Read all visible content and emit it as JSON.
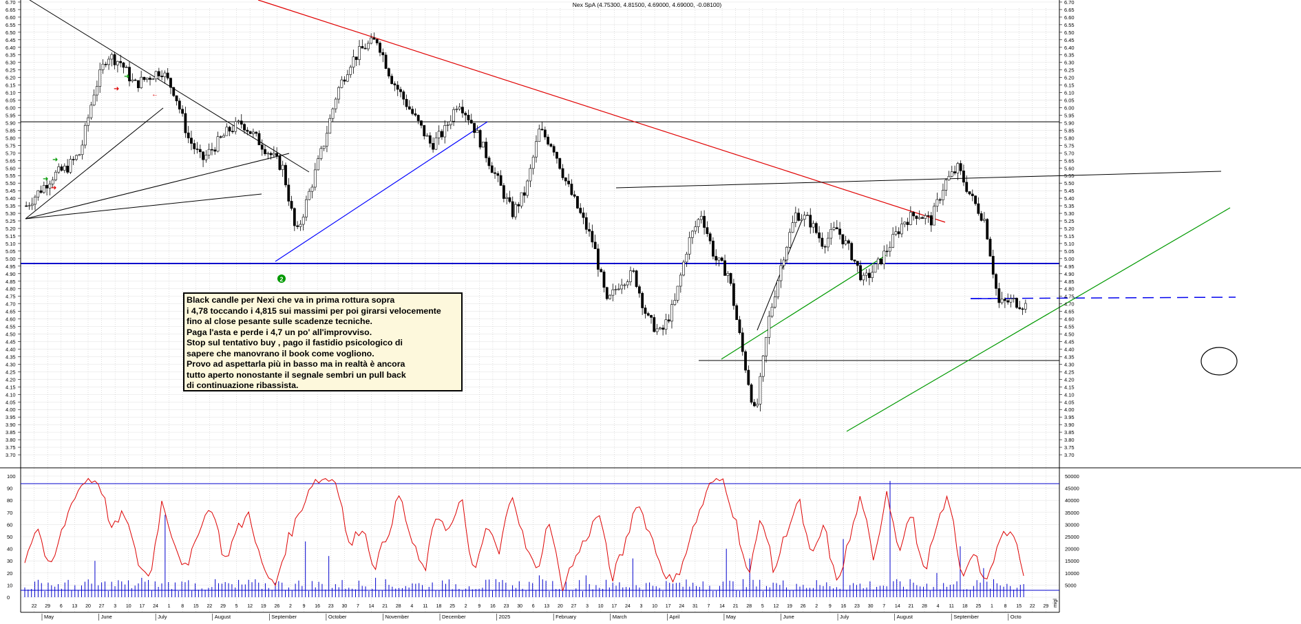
{
  "title": "Nex SpA (4.75300, 4.81500, 4.69000, 4.69000, -0.08100)",
  "colors": {
    "up_candle": "#ffffff",
    "down_candle": "#000000",
    "support_line": "#0000cc",
    "red_trendline": "#e00000",
    "blue_trendline": "#0000ff",
    "green_trendline": "#009900",
    "oscillator": "#dd0000",
    "volume": "#0000cc",
    "annotation_bg": "#fdf8dc"
  },
  "annotation": {
    "lines": [
      "Black candle per Nexi che va in prima rottura sopra",
      "i 4,78 toccando i 4,815 sui massimi per poi girarsi velocemente",
      "fino al close pesante sulle scadenze tecniche.",
      "Paga l'asta e perde i 4,7 un po' all'improvviso.",
      "Stop sul tentativo buy , pago il fastidio psicologico di",
      "sapere che manovrano il book come vogliono.",
      "Provo ad aspettarla più in basso ma in realtà è ancora",
      "tutto aperto nonostante il segnale sembri un pull back",
      "di continuazione ribassista."
    ]
  },
  "marker_label": "2",
  "volume_axis_unit": "migl",
  "chart_data": [
    {
      "type": "candlestick",
      "title": "Nex SpA (4.75300, 4.81500, 4.69000, 4.69000, -0.08100)",
      "ylim": [
        3.65,
        6.75
      ],
      "y_ticks": [
        "6.70",
        "6.65",
        "6.60",
        "6.55",
        "6.50",
        "6.45",
        "6.40",
        "6.35",
        "6.30",
        "6.25",
        "6.20",
        "6.15",
        "6.10",
        "6.05",
        "6.00",
        "5.95",
        "5.90",
        "5.85",
        "5.80",
        "5.75",
        "5.70",
        "5.65",
        "5.60",
        "5.55",
        "5.50",
        "5.45",
        "5.40",
        "5.35",
        "5.30",
        "5.25",
        "5.20",
        "5.15",
        "5.10",
        "5.05",
        "5.00",
        "4.95",
        "4.90",
        "4.85",
        "4.80",
        "4.75",
        "4.70",
        "4.65",
        "4.60",
        "4.55",
        "4.50",
        "4.45",
        "4.40",
        "4.35",
        "4.30",
        "4.25",
        "4.20",
        "4.15",
        "4.10",
        "4.05",
        "4.00",
        "3.95",
        "3.90",
        "3.85",
        "3.80",
        "3.75",
        "3.70"
      ],
      "last_candle": {
        "open": 4.753,
        "high": 4.815,
        "low": 4.69,
        "close": 4.69,
        "change": -0.081
      },
      "price_path": [
        5.35,
        5.45,
        5.55,
        5.6,
        5.7,
        6.1,
        6.35,
        6.3,
        6.15,
        6.2,
        6.25,
        6.1,
        5.8,
        5.65,
        5.75,
        5.85,
        5.9,
        5.8,
        5.7,
        5.6,
        5.15,
        5.45,
        5.75,
        6.1,
        6.3,
        6.4,
        6.45,
        6.2,
        6.05,
        5.9,
        5.75,
        5.85,
        6.05,
        5.9,
        5.7,
        5.5,
        5.3,
        5.45,
        5.85,
        5.75,
        5.5,
        5.3,
        5.1,
        4.7,
        4.85,
        4.9,
        4.6,
        4.5,
        4.7,
        5.1,
        5.3,
        5.0,
        4.9,
        4.4,
        3.95,
        4.6,
        5.0,
        5.3,
        5.25,
        5.1,
        5.2,
        5.05,
        4.85,
        4.95,
        5.1,
        5.25,
        5.3,
        5.25,
        5.5,
        5.6,
        5.4,
        5.25,
        4.7,
        4.72,
        4.69
      ],
      "horizontal_lines": [
        {
          "label": "resistance",
          "y": 5.97
        },
        {
          "label": "support",
          "y": 5.02
        },
        {
          "label": "low support",
          "y": 4.37
        },
        {
          "label": "dashed level",
          "y": 4.785
        }
      ]
    },
    {
      "type": "line",
      "name": "oscillator",
      "ylim": [
        0,
        100
      ],
      "y_ticks": [
        "100",
        "90",
        "80",
        "70",
        "60",
        "50",
        "40",
        "30",
        "20",
        "10",
        "0"
      ],
      "upper_level": 92,
      "lower_level": 10,
      "values": [
        32,
        60,
        20,
        55,
        85,
        98,
        95,
        55,
        70,
        30,
        15,
        80,
        45,
        20,
        60,
        75,
        30,
        55,
        70,
        25,
        8,
        45,
        70,
        95,
        98,
        97,
        40,
        60,
        25,
        50,
        85,
        45,
        20,
        70,
        55,
        80,
        15,
        60,
        35,
        90,
        45,
        20,
        65,
        8,
        30,
        50,
        70,
        15,
        40,
        80,
        55,
        25,
        10,
        40,
        70,
        95,
        97,
        60,
        15,
        70,
        20,
        55,
        80,
        30,
        60,
        10,
        45,
        85,
        25,
        90,
        40,
        70,
        20,
        55,
        85,
        15,
        40,
        8,
        45,
        60,
        20
      ]
    },
    {
      "type": "bar",
      "name": "volume",
      "ylim": [
        0,
        50000
      ],
      "y_ticks": [
        "50000",
        "45000",
        "40000",
        "35000",
        "30000",
        "25000",
        "20000",
        "15000",
        "10000",
        "5000"
      ],
      "values": [
        4000,
        5500,
        3000,
        7000,
        21000,
        4500,
        3500,
        6000,
        5000,
        3800,
        4200,
        12000,
        6000,
        8000,
        3000,
        24000,
        9000,
        4000,
        5500,
        6500,
        3800,
        15000,
        4000,
        3300,
        6000,
        11000,
        20000,
        5000,
        7000,
        48000,
        9000,
        6000,
        12000,
        16000,
        5500,
        8000,
        6000,
        4000,
        23000,
        11000,
        6000,
        4500,
        34000,
        10000,
        16000,
        17000
      ]
    }
  ],
  "x_axis": {
    "day_labels": [
      "22",
      "29",
      "6",
      "13",
      "20",
      "27",
      "3",
      "10",
      "17",
      "24",
      "1",
      "8",
      "15",
      "22",
      "29",
      "5",
      "12",
      "19",
      "26",
      "2",
      "9",
      "16",
      "23",
      "30",
      "7",
      "14",
      "21",
      "28",
      "4",
      "11",
      "18",
      "25",
      "2",
      "9",
      "16",
      "23",
      "30",
      "6",
      "13",
      "20",
      "27",
      "3",
      "10",
      "17",
      "24",
      "3",
      "10",
      "17",
      "24",
      "31",
      "7",
      "14",
      "21",
      "28",
      "5",
      "12",
      "19",
      "26",
      "2",
      "9",
      "16",
      "23",
      "30",
      "7",
      "14",
      "21",
      "28",
      "4",
      "11",
      "18",
      "25",
      "1",
      "8",
      "15",
      "22",
      "29"
    ],
    "month_labels": [
      "May",
      "June",
      "July",
      "August",
      "September",
      "October",
      "November",
      "December",
      "2025",
      "February",
      "March",
      "April",
      "May",
      "June",
      "July",
      "August",
      "September",
      "Octo"
    ]
  }
}
